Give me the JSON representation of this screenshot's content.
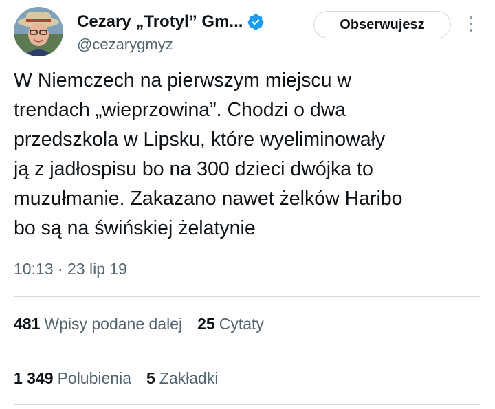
{
  "author": {
    "display_name": "Cezary „Trotyl” Gm...",
    "handle": "@cezarygmyz",
    "verified_icon": "verified-badge-icon",
    "verified_color": "#1d9bf0"
  },
  "follow_button_label": "Obserwujesz",
  "tweet": {
    "text": "W Niemczech na pierwszym miejscu w\ntrendach „wieprzowina”.  Chodzi o dwa\nprzedszkola w Lipsku, które wyeliminowały\nją z jadłospisu bo na 300 dzieci dwójka to\nmuzułmanie. Zakazano nawet żelków Haribo\nbo są na świńskiej żelatynie",
    "timestamp": "10:13 · 23 lip 19"
  },
  "stats": {
    "retweets": {
      "count": "481",
      "label": "Wpisy podane dalej"
    },
    "quotes": {
      "count": "25",
      "label": "Cytaty"
    },
    "likes": {
      "count": "1 349",
      "label": "Polubienia"
    },
    "bookmarks": {
      "count": "5",
      "label": "Zakładki"
    }
  },
  "colors": {
    "text": "#0f1419",
    "secondary": "#536471",
    "divider": "#cfd9de"
  }
}
